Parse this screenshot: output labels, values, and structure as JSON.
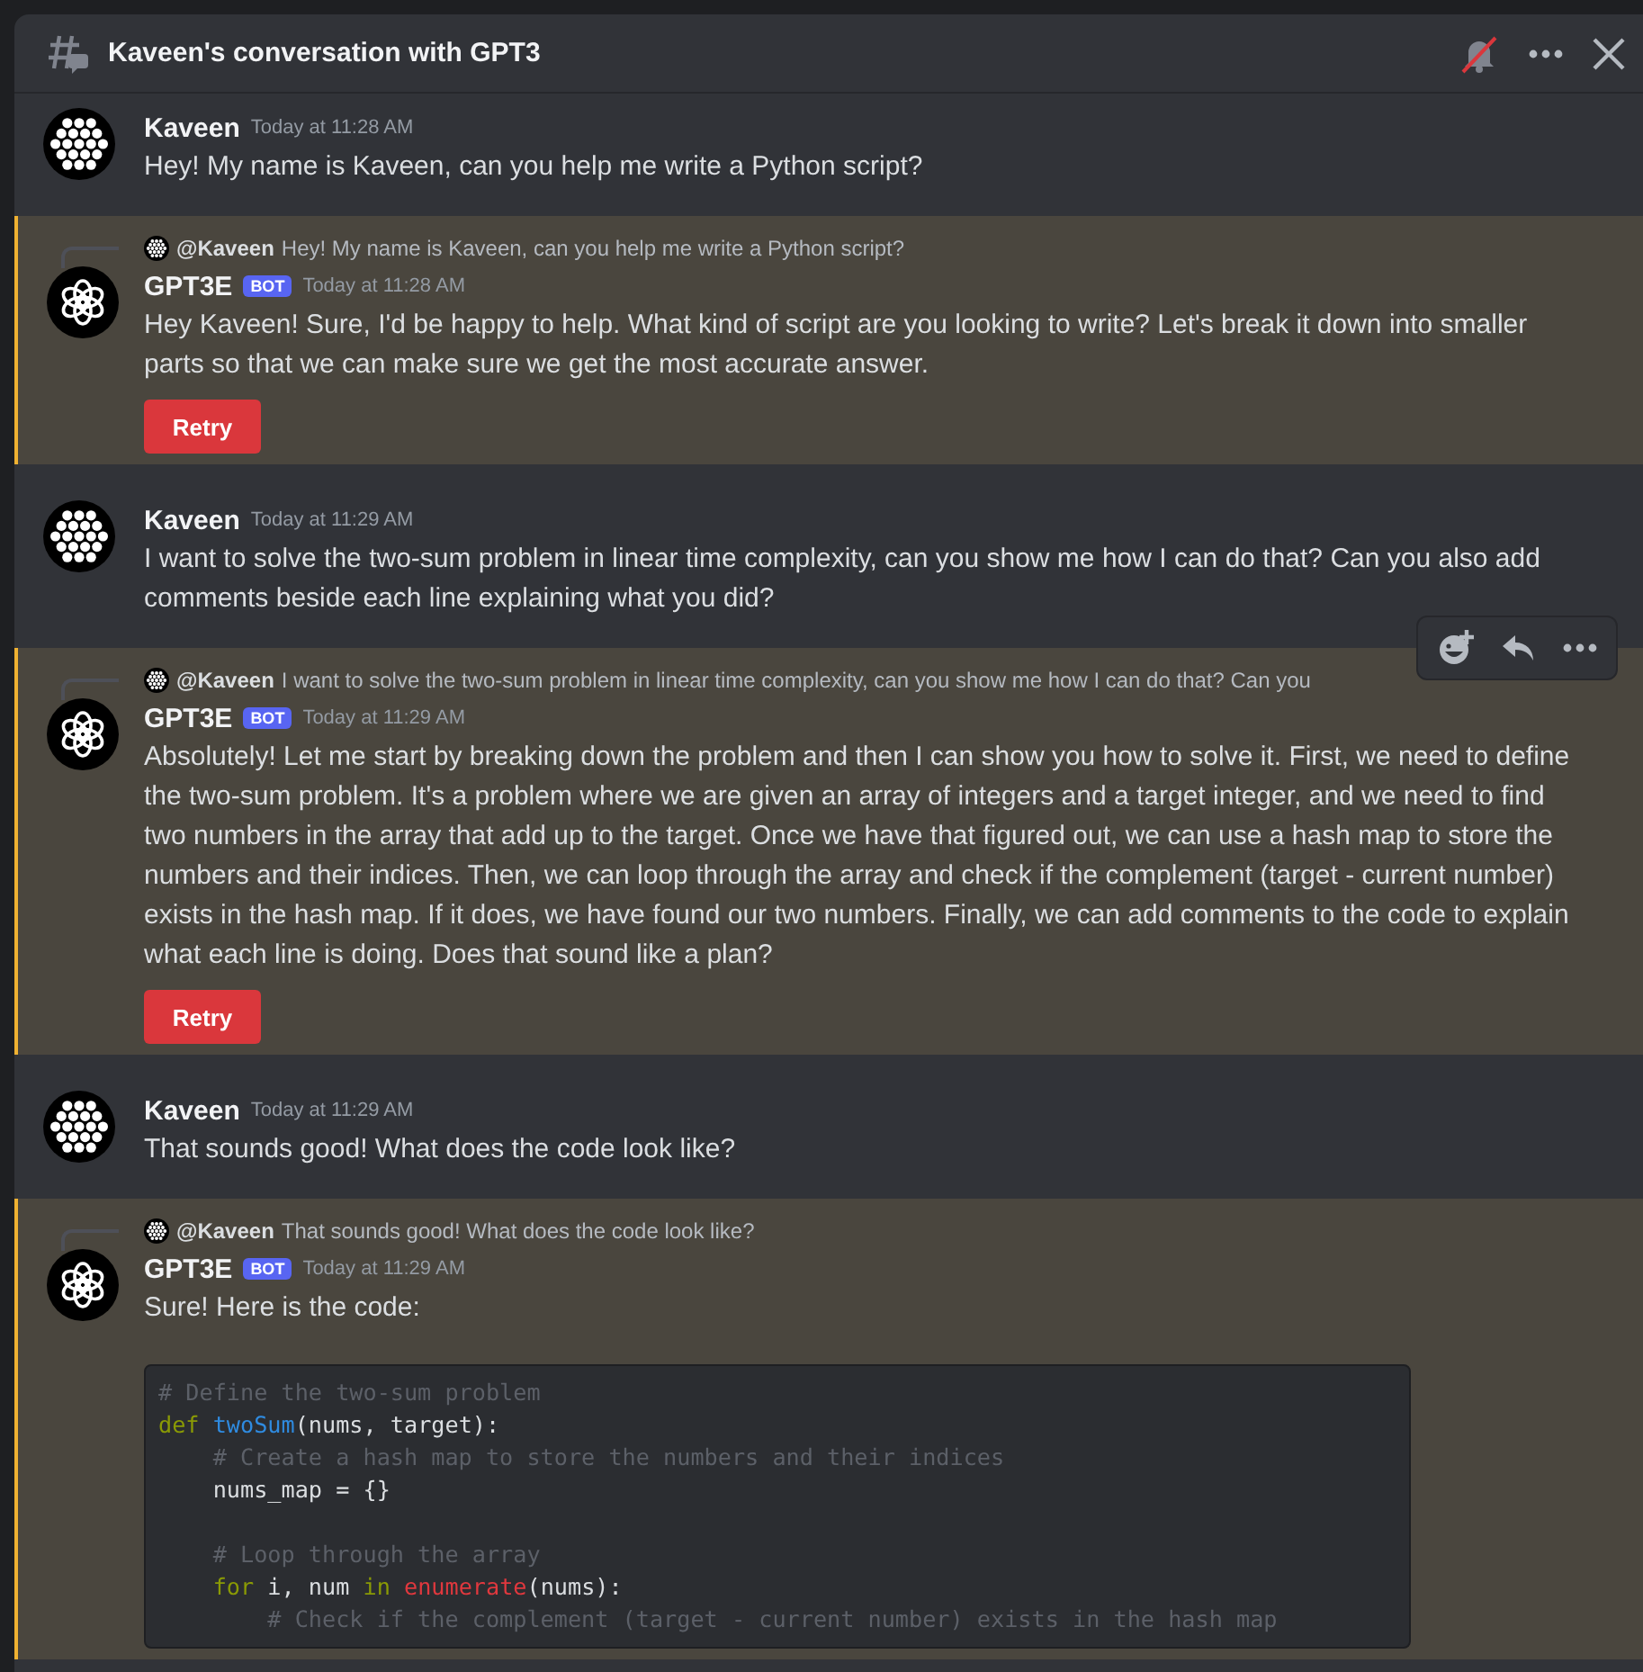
{
  "window": {
    "title": "Kaveen's conversation with GPT3"
  },
  "messages": [
    {
      "kind": "user",
      "mentioned": false,
      "hovered": false,
      "author": "Kaveen",
      "time": "Today at 11:28 AM",
      "text": "Hey! My name is Kaveen, can you help me write a Python script?"
    },
    {
      "kind": "bot",
      "mentioned": true,
      "hovered": false,
      "reply": {
        "author": "@Kaveen",
        "text": "Hey! My name is Kaveen, can you help me write a Python script?"
      },
      "author": "GPT3E",
      "tag": "BOT",
      "time": "Today at 11:28 AM",
      "text": "Hey Kaveen! Sure, I'd be happy to help. What kind of script are you looking to write? Let's break it down into smaller parts so that we can make sure we get the most accurate answer.",
      "button": "Retry"
    },
    {
      "kind": "user",
      "mentioned": false,
      "hovered": false,
      "author": "Kaveen",
      "time": "Today at 11:29 AM",
      "text": "I want to solve the two-sum problem in linear time complexity, can you show me how I can do that? Can you also add comments beside each line explaining what you did?"
    },
    {
      "kind": "bot",
      "mentioned": true,
      "hovered": true,
      "reply": {
        "author": "@Kaveen",
        "text": "I want to solve the two-sum problem in linear time complexity, can you show me how I can do that? Can you"
      },
      "author": "GPT3E",
      "tag": "BOT",
      "time": "Today at 11:29 AM",
      "text": "Absolutely! Let me start by breaking down the problem and then I can show you how to solve it. First, we need to define the two-sum problem. It's a problem where we are given an array of integers and a target integer, and we need to find two numbers in the array that add up to the target. Once we have that figured out, we can use a hash map to store the numbers and their indices. Then, we can loop through the array and check if the complement (target - current number) exists in the hash map. If it does, we have found our two numbers. Finally, we can add comments to the code to explain what each line is doing. Does that sound like a plan?",
      "button": "Retry"
    },
    {
      "kind": "user",
      "mentioned": false,
      "hovered": false,
      "author": "Kaveen",
      "time": "Today at 11:29 AM",
      "text": "That sounds good! What does the code look like?"
    },
    {
      "kind": "bot",
      "mentioned": true,
      "hovered": false,
      "reply": {
        "author": "@Kaveen",
        "text": "That sounds good! What does the code look like?"
      },
      "author": "GPT3E",
      "tag": "BOT",
      "time": "Today at 11:29 AM",
      "text": "Sure! Here is the code:",
      "code": [
        [
          {
            "kind": "comment",
            "text": "# Define the two-sum problem"
          }
        ],
        [
          {
            "kind": "keyword",
            "text": "def "
          },
          {
            "kind": "function",
            "text": "twoSum"
          },
          {
            "kind": "plain",
            "text": "(nums, target):"
          }
        ],
        [
          {
            "kind": "comment",
            "text": "    # Create a hash map to store the numbers and their indices"
          }
        ],
        [
          {
            "kind": "plain",
            "text": "    nums_map = {}"
          }
        ],
        [
          {
            "kind": "blank"
          }
        ],
        [
          {
            "kind": "comment",
            "text": "    # Loop through the array"
          }
        ],
        [
          {
            "kind": "keyword",
            "text": "    for"
          },
          {
            "kind": "plain",
            "text": " i, num "
          },
          {
            "kind": "keyword",
            "text": "in "
          },
          {
            "kind": "builtin",
            "text": "enumerate"
          },
          {
            "kind": "plain",
            "text": "(nums):"
          }
        ],
        [
          {
            "kind": "comment",
            "text": "        # Check if the complement (target - current number) exists in the hash map"
          }
        ]
      ]
    }
  ]
}
